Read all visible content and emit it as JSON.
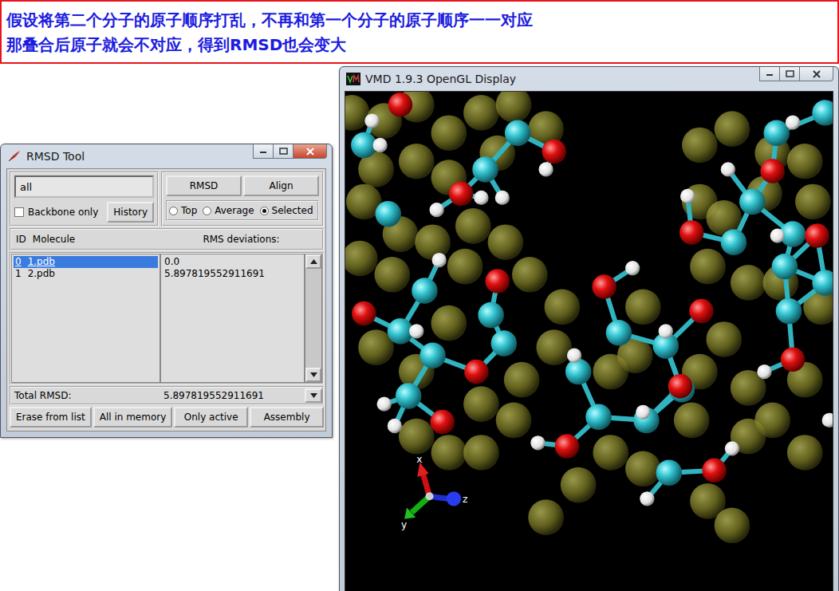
{
  "banner": {
    "lines": [
      "假设将第二个分子的原子顺序打乱，不再和第一个分子的原子顺序一一对应",
      "那叠合后原子就会不对应，得到RMSD也会变大"
    ]
  },
  "rmsd_window": {
    "title": "RMSD Tool",
    "active": true,
    "selection": "all",
    "action_buttons": [
      "RMSD",
      "Align"
    ],
    "backbone_only": {
      "label": "Backbone only",
      "checked": false
    },
    "history_button": "History",
    "reference": [
      {
        "label": "Top",
        "selected": false
      },
      {
        "label": "Average",
        "selected": false
      },
      {
        "label": "Selected",
        "selected": true
      }
    ],
    "columns": {
      "id": "ID",
      "molecule": "Molecule",
      "rmsd": "RMS deviations:"
    },
    "rows": [
      {
        "id": "0",
        "molecule": "1.pdb",
        "rmsd": "0.0",
        "selected": true
      },
      {
        "id": "1",
        "molecule": "2.pdb",
        "rmsd": "5.897819552911691",
        "selected": false
      }
    ],
    "total": {
      "label": "Total RMSD:",
      "value": "5.897819552911691"
    },
    "bottom_buttons": [
      "Erase from list",
      "All in memory",
      "Only active",
      "Assembly"
    ]
  },
  "vmd_window": {
    "title": "VMD 1.9.3 OpenGL Display",
    "active": false,
    "axes": [
      "x",
      "y",
      "z"
    ]
  }
}
